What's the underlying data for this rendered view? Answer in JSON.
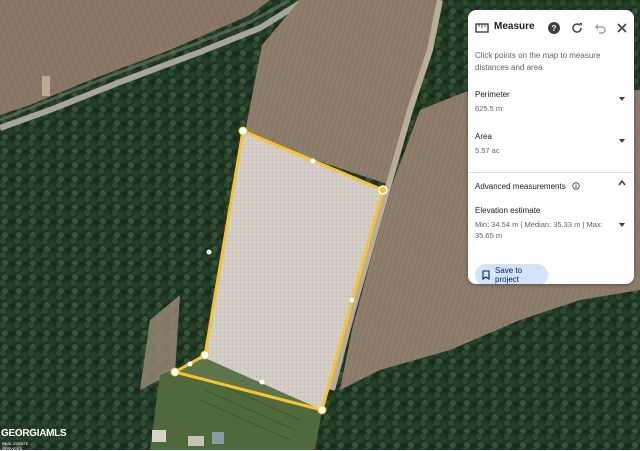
{
  "panel": {
    "title": "Measure",
    "hint": "Click points on the map to measure distances and area",
    "icons": {
      "ruler": "ruler-icon",
      "help": "help-icon",
      "refresh": "refresh-icon",
      "undo": "undo-icon",
      "close": "close-icon"
    },
    "perimeter": {
      "label": "Perimeter",
      "value": "625.5 m"
    },
    "area": {
      "label": "Area",
      "value": "5.57 ac"
    },
    "advanced": {
      "label": "Advanced measurements"
    },
    "elevation": {
      "label": "Elevation estimate",
      "value": "Min: 34.54 m | Median: 35.33 m | Max: 35.65 m"
    },
    "save_label": "Save to project"
  },
  "watermark": {
    "brand": "GEORGIAMLS",
    "tagline": "REAL ESTATE SERVICES"
  },
  "colors": {
    "measure_outline": "#f9c22e",
    "save_button_bg": "#d3e3fd",
    "panel_bg": "#ffffff"
  }
}
